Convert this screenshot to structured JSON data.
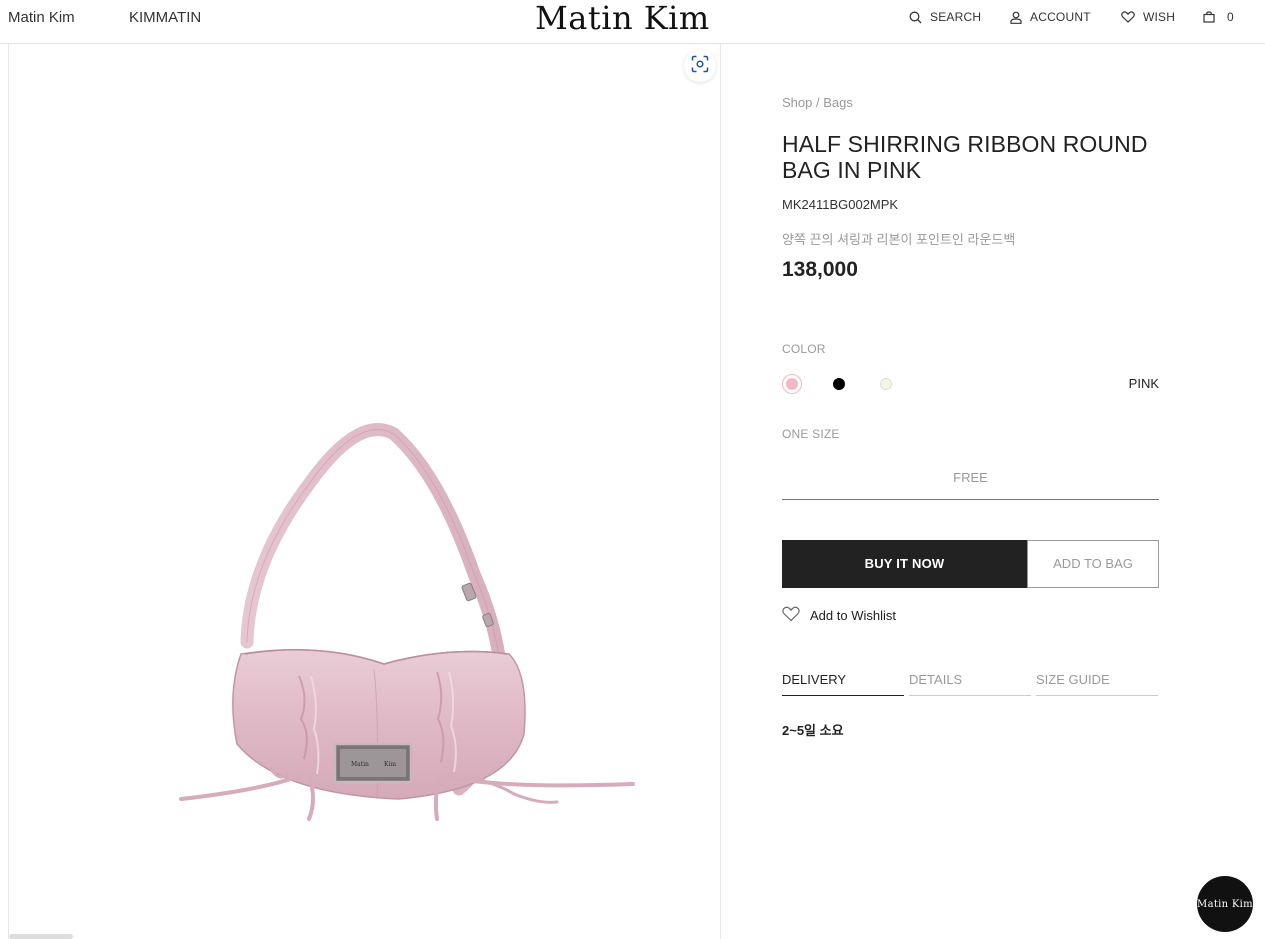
{
  "header": {
    "brand_left": "Matin Kim",
    "brand_left2": "KIMMATIN",
    "logo": "Matin Kim",
    "search_label": "SEARCH",
    "account_label": "ACCOUNT",
    "wish_label": "WISH",
    "cart_count": "0"
  },
  "product": {
    "breadcrumb": "Shop / Bags",
    "title": "HALF SHIRRING RIBBON ROUND BAG IN PINK",
    "code": "MK2411BG002MPK",
    "description": "양쪽 끈의 셔링과 리본이 포인트인 라운드백",
    "price": "138,000",
    "image_alt": "pink shirring ribbon round bag",
    "badge_left": "Matin",
    "badge_right": "Kim"
  },
  "options": {
    "color_label": "COLOR",
    "colors": [
      {
        "name": "pink",
        "hex": "#f3b9c6",
        "selected": true
      },
      {
        "name": "black",
        "hex": "#000000",
        "selected": false
      },
      {
        "name": "ivory",
        "hex": "#f6f5e2",
        "selected": false
      }
    ],
    "selected_color": "PINK",
    "size_label": "ONE SIZE",
    "size_value": "FREE"
  },
  "actions": {
    "buy_now": "BUY IT NOW",
    "add_to_bag": "ADD TO BAG",
    "wishlist": "Add to Wishlist"
  },
  "tabs": {
    "items": [
      "DELIVERY",
      "DETAILS",
      "SIZE GUIDE"
    ],
    "active": "DELIVERY",
    "delivery_text": "2~5일 소요"
  },
  "floating": {
    "logo_text": "Matin Kim"
  }
}
